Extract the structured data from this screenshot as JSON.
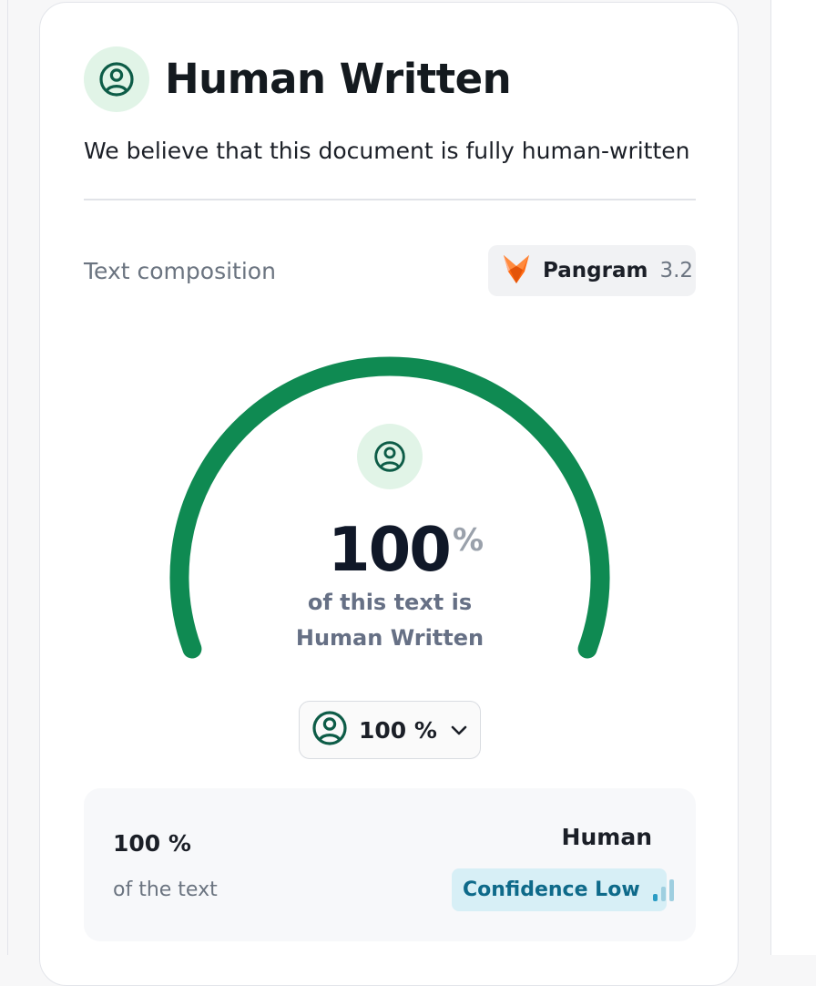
{
  "header": {
    "icon": "user-circle-icon",
    "title": "Human Written",
    "subtitle": "We believe that this document is fully human-written"
  },
  "composition": {
    "label": "Text composition",
    "model": {
      "logo": "fox-logo-icon",
      "name": "Pangram",
      "version": "3.2"
    }
  },
  "gauge": {
    "icon": "user-circle-icon",
    "value": "100",
    "unit": "%",
    "fill_fraction": 1.0,
    "line1": "of this text is",
    "line2": "Human Written",
    "colors": {
      "track": "#0f8a52",
      "icon_bg": "#e1f4e7",
      "icon": "#0d5c47"
    }
  },
  "selector": {
    "icon": "user-circle-icon",
    "value": "100 %",
    "chevron": "chevron-down-icon"
  },
  "summary": {
    "value": "100 %",
    "caption": "of the text",
    "classification": "Human",
    "confidence": {
      "label": "Confidence Low",
      "icon": "signal-bars-icon",
      "level": "low",
      "colors": {
        "bg": "#d7eff6",
        "text": "#0e6a8a",
        "bar_on": "#2a9cc4",
        "bar_off": "#9fcfe0"
      }
    }
  }
}
